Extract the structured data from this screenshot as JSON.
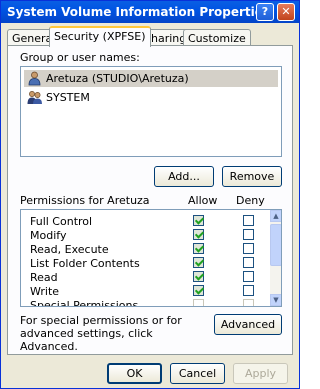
{
  "window": {
    "title": "System Volume Information Properties"
  },
  "titlebar": {
    "help_glyph": "?",
    "close_glyph": "✕"
  },
  "tabs": [
    {
      "label": "General"
    },
    {
      "label": "Security (XPFSE)"
    },
    {
      "label": "Sharing"
    },
    {
      "label": "Customize"
    }
  ],
  "groups": {
    "label": "Group or user names:",
    "users": [
      {
        "name": "Aretuza (STUDIO\\Aretuza)"
      },
      {
        "name": "SYSTEM"
      }
    ]
  },
  "buttons": {
    "add": "Add...",
    "remove": "Remove",
    "advanced": "Advanced",
    "ok": "OK",
    "cancel": "Cancel",
    "apply": "Apply"
  },
  "permissions": {
    "label": "Permissions for Aretuza",
    "allow_header": "Allow",
    "deny_header": "Deny",
    "rows": [
      {
        "name": "Full Control",
        "allow": true,
        "deny": false
      },
      {
        "name": "Modify",
        "allow": true,
        "deny": false
      },
      {
        "name": "Read, Execute",
        "allow": true,
        "deny": false
      },
      {
        "name": "List Folder Contents",
        "allow": true,
        "deny": false
      },
      {
        "name": "Read",
        "allow": true,
        "deny": false
      },
      {
        "name": "Write",
        "allow": true,
        "deny": false
      },
      {
        "name": "Special Permissions",
        "allow": false,
        "deny": false
      }
    ]
  },
  "advanced_note": "For special permissions or for advanced settings, click Advanced."
}
